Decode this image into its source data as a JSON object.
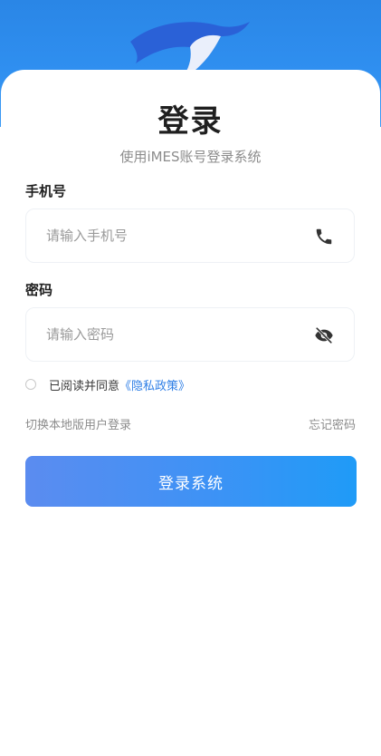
{
  "header": {
    "title": "登录",
    "subtitle": "使用iMES账号登录系统"
  },
  "form": {
    "phone_label": "手机号",
    "phone_placeholder": "请输入手机号",
    "phone_icon": "phone-icon",
    "password_label": "密码",
    "password_placeholder": "请输入密码",
    "password_icon": "eye-off-icon"
  },
  "agreement": {
    "checked": false,
    "prefix": "已阅读并同意",
    "policy_link": "《隐私政策》"
  },
  "links": {
    "local_login": "切换本地版用户登录",
    "forgot_password": "忘记密码"
  },
  "submit_label": "登录系统",
  "colors": {
    "banner_blue": "#2f8ff0",
    "link_blue": "#2f7fe6",
    "button_start": "#5b8cf0",
    "button_end": "#1f9bf7"
  }
}
